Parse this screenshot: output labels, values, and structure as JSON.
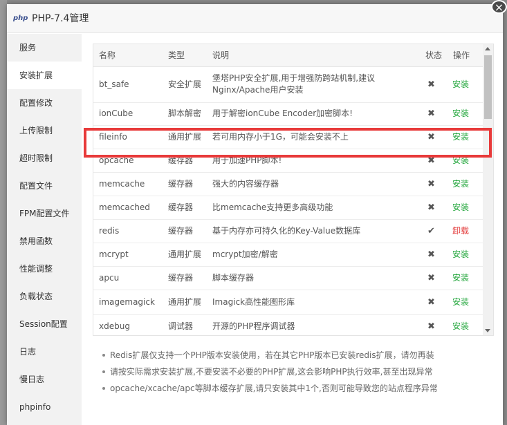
{
  "dialog": {
    "logo_text": "php",
    "title": "PHP-7.4管理",
    "close_glyph": "×"
  },
  "sidebar": {
    "items": [
      {
        "label": "服务"
      },
      {
        "label": "安装扩展"
      },
      {
        "label": "配置修改"
      },
      {
        "label": "上传限制"
      },
      {
        "label": "超时限制"
      },
      {
        "label": "配置文件"
      },
      {
        "label": "FPM配置文件"
      },
      {
        "label": "禁用函数"
      },
      {
        "label": "性能调整"
      },
      {
        "label": "负载状态"
      },
      {
        "label": "Session配置"
      },
      {
        "label": "日志"
      },
      {
        "label": "慢日志"
      },
      {
        "label": "phpinfo"
      }
    ],
    "active_index": 1
  },
  "table": {
    "headers": {
      "name": "名称",
      "type": "类型",
      "desc": "说明",
      "status": "状态",
      "action": "操作"
    },
    "rows": [
      {
        "name": "bt_safe",
        "type": "安全扩展",
        "desc": "堡塔PHP安全扩展,用于增强防跨站机制,建议Nginx/Apache用户安装",
        "status": "✖",
        "action": "安装"
      },
      {
        "name": "ionCube",
        "type": "脚本解密",
        "desc": "用于解密ionCube Encoder加密脚本!",
        "status": "✖",
        "action": "安装"
      },
      {
        "name": "fileinfo",
        "type": "通用扩展",
        "desc": "若可用内存小于1G，可能会安装不上",
        "status": "✖",
        "action": "安装"
      },
      {
        "name": "opcache",
        "type": "缓存器",
        "desc": "用于加速PHP脚本!",
        "status": "✖",
        "action": "安装"
      },
      {
        "name": "memcache",
        "type": "缓存器",
        "desc": "强大的内容缓存器",
        "status": "✖",
        "action": "安装"
      },
      {
        "name": "memcached",
        "type": "缓存器",
        "desc": "比memcache支持更多高级功能",
        "status": "✖",
        "action": "安装"
      },
      {
        "name": "redis",
        "type": "缓存器",
        "desc": "基于内存亦可持久化的Key-Value数据库",
        "status": "✔",
        "action": "卸载"
      },
      {
        "name": "mcrypt",
        "type": "通用扩展",
        "desc": "mcrypt加密/解密",
        "status": "✖",
        "action": "安装"
      },
      {
        "name": "apcu",
        "type": "缓存器",
        "desc": "脚本缓存器",
        "status": "✖",
        "action": "安装"
      },
      {
        "name": "imagemagick",
        "type": "通用扩展",
        "desc": "Imagick高性能图形库",
        "status": "✖",
        "action": "安装"
      },
      {
        "name": "xdebug",
        "type": "调试器",
        "desc": "开源的PHP程序调试器",
        "status": "✖",
        "action": "安装"
      }
    ]
  },
  "notes": [
    "Redis扩展仅支持一个PHP版本安装使用，若在其它PHP版本已安装redis扩展，请勿再装",
    "请按实际需求安装扩展,不要安装不必要的PHP扩展,这会影响PHP执行效率,甚至出现异常",
    "opcache/xcache/apc等脚本缓存扩展,请只安装其中1个,否则可能导致您的站点程序异常"
  ],
  "colors": {
    "install": "#20a53a",
    "uninstall": "#e33b3b",
    "highlight": "#e83a3a"
  }
}
